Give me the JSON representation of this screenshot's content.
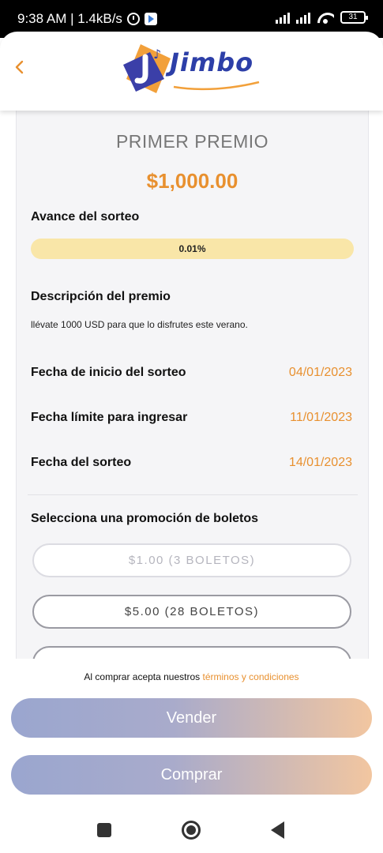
{
  "status_bar": {
    "time_speed": "9:38 AM | 1.4kB/s",
    "battery": "31"
  },
  "header": {
    "logo_text": "Jimbo",
    "icons": {
      "back": "chevron-left-icon"
    }
  },
  "prize": {
    "title": "PRIMER PREMIO",
    "amount": "$1,000.00",
    "progress_label": "Avance del sorteo",
    "progress_value": "0.01%",
    "progress_fraction": 0.0001,
    "description_label": "Descripción del premio",
    "description_text": "llévate 1000 USD para que lo disfrutes este verano."
  },
  "dates": [
    {
      "label": "Fecha de inicio del sorteo",
      "value": "04/01/2023"
    },
    {
      "label": "Fecha límite para ingresar",
      "value": "11/01/2023"
    },
    {
      "label": "Fecha del sorteo",
      "value": "14/01/2023"
    }
  ],
  "promotions": {
    "label": "Selecciona una promoción de boletos",
    "options": [
      {
        "label": "$1.00 (3 BOLETOS)"
      },
      {
        "label": "$5.00 (28 BOLETOS)"
      },
      {
        "label": ""
      }
    ]
  },
  "footer": {
    "terms_prefix": "Al comprar acepta nuestros ",
    "terms_link": "términos y condiciones",
    "sell_label": "Vender",
    "buy_label": "Comprar"
  },
  "colors": {
    "accent": "#e8902f",
    "progress_track": "#f9e6a8",
    "button_gradient_start": "#9aa6cf",
    "button_gradient_end": "#f2c6a0",
    "brand_blue": "#2d3fa8"
  }
}
